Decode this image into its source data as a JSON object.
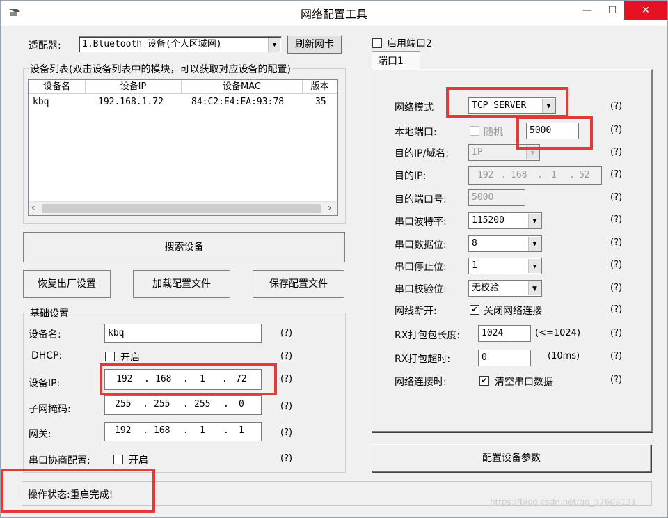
{
  "window": {
    "title": "网络配置工具",
    "minimize": "—",
    "maximize": "☐",
    "close": "✕"
  },
  "left": {
    "adapter_label": "适配器:",
    "adapter_value": "1.Bluetooth 设备(个人区域网)",
    "refresh_button": "刷新网卡",
    "device_list_legend": "设备列表(双击设备列表中的模块，可以获取对应设备的配置)",
    "columns": [
      "设备名",
      "设备IP",
      "设备MAC",
      "版本"
    ],
    "rows": [
      {
        "name": "kbq",
        "ip": "192.168.1.72",
        "mac": "84:C2:E4:EA:93:78",
        "ver": "35"
      }
    ],
    "search_button": "搜索设备",
    "factory_reset_button": "恢复出厂设置",
    "load_config_button": "加载配置文件",
    "save_config_button": "保存配置文件",
    "basic_legend": "基础设置",
    "device_name_label": "设备名:",
    "device_name_value": "kbq",
    "dhcp_label": "DHCP:",
    "dhcp_option": "开启",
    "device_ip_label": "设备IP:",
    "device_ip": [
      "192",
      "168",
      "1",
      "72"
    ],
    "subnet_label": "子网掩码:",
    "subnet": [
      "255",
      "255",
      "255",
      "0"
    ],
    "gateway_label": "网关:",
    "gateway": [
      "192",
      "168",
      "1",
      "1"
    ],
    "serial_neg_label": "串口协商配置:",
    "serial_neg_option": "开启",
    "help": "(?)"
  },
  "right": {
    "enable_port2": "启用端口2",
    "tab_port1": "端口1",
    "network_mode_label": "网络模式",
    "network_mode_value": "TCP SERVER",
    "local_port_label": "本地端口:",
    "random_label": "随机",
    "local_port_value": "5000",
    "dest_ip_domain_label": "目的IP/域名:",
    "dest_ip_domain_value": "IP",
    "dest_ip_label": "目的IP:",
    "dest_ip": [
      "192",
      "168",
      "1",
      "52"
    ],
    "dest_port_label": "目的端口号:",
    "dest_port_value": "5000",
    "baud_label": "串口波特率:",
    "baud_value": "115200",
    "databits_label": "串口数据位:",
    "databits_value": "8",
    "stopbits_label": "串口停止位:",
    "stopbits_value": "1",
    "parity_label": "串口校验位:",
    "parity_value": "无校验",
    "disconnect_label": "网线断开:",
    "disconnect_option": "关闭网络连接",
    "rx_len_label": "RX打包包长度:",
    "rx_len_value": "1024",
    "rx_len_hint": "(<=1024)",
    "rx_timeout_label": "RX打包超时:",
    "rx_timeout_value": "0",
    "rx_timeout_hint": "(10ms)",
    "net_conn_label": "网络连接时:",
    "net_conn_option": "清空串口数据",
    "config_button": "配置设备参数",
    "help": "(?)"
  },
  "status": {
    "text": "操作状态:重启完成!",
    "watermark": "https://blog.csdn.net/qq_37603131"
  },
  "colors": {
    "highlight_red": "#e53935",
    "close_red": "#e81123",
    "window_bg": "#f0f0f0"
  }
}
